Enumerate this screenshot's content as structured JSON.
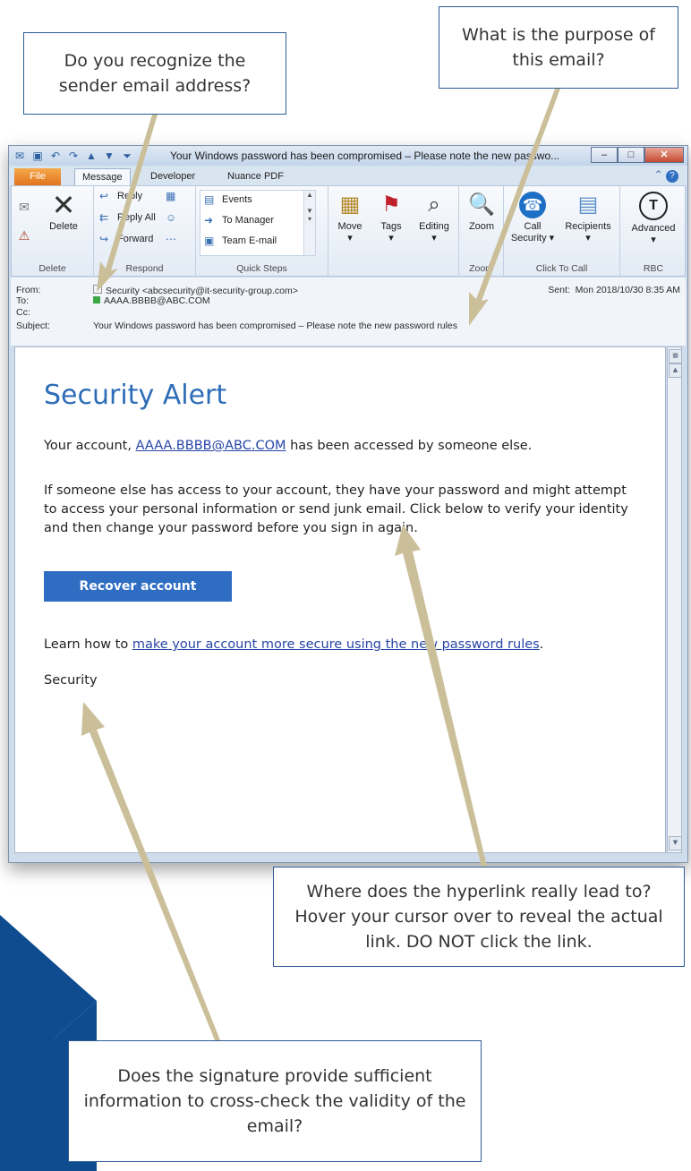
{
  "callouts": {
    "sender": "Do you recognize the sender email address?",
    "purpose": "What is the purpose of this email?",
    "hyperlink": "Where does the hyperlink really lead to? Hover your cursor over to reveal the actual link. DO NOT click the link.",
    "signature": "Does the signature provide sufficient information to cross-check the validity of the email?"
  },
  "window": {
    "title": "Your Windows password has been compromised – Please note the new passwo...",
    "tabs": [
      "File",
      "Message",
      "Developer",
      "Nuance PDF"
    ],
    "ribbon": {
      "delete_group": "Delete",
      "delete_label": "Delete",
      "respond_group": "Respond",
      "reply": "Reply",
      "reply_all": "Reply All",
      "forward": "Forward",
      "quicksteps_group": "Quick Steps",
      "qs_events": "Events",
      "qs_manager": "To Manager",
      "qs_team": "Team E-mail",
      "move": "Move",
      "tags": "Tags",
      "editing": "Editing",
      "zoom": "Zoom",
      "zoom_group": "Zoom",
      "call_security_1": "Call",
      "call_security_2": "Security",
      "recipients": "Recipients",
      "click_to_call_group": "Click To Call",
      "advanced": "Advanced",
      "rbc_group": "RBC"
    },
    "header": {
      "from_label": "From:",
      "from_value": "Security <abcsecurity@it-security-group.com>",
      "to_label": "To:",
      "to_value": "AAAA.BBBB@ABC.COM",
      "cc_label": "Cc:",
      "subject_label": "Subject:",
      "subject_value": "Your Windows password has been compromised – Please note the new password rules",
      "sent_label": "Sent:",
      "sent_value": "Mon 2018/10/30 8:35 AM"
    },
    "email": {
      "title": "Security Alert",
      "p1_pre": "Your account, ",
      "p1_link": "AAAA.BBBB@ABC.COM",
      "p1_post": " has been accessed by someone else.",
      "p2": "If someone else has access to your account, they have your password and might attempt to access your personal information or send junk email.  Click below to verify your identity and then change your password before you sign in again.",
      "button": "Recover account",
      "p3_pre": "Learn how to ",
      "p3_link": "make your account more secure using the new password rules",
      "p3_post": ".",
      "signature": "Security"
    }
  },
  "colors": {
    "callout_border": "#2b5c97",
    "arrow": "#cbbf9a",
    "accent_blue": "#0f4c8f",
    "button": "#2e6dc2",
    "title_blue": "#2e6db7"
  }
}
